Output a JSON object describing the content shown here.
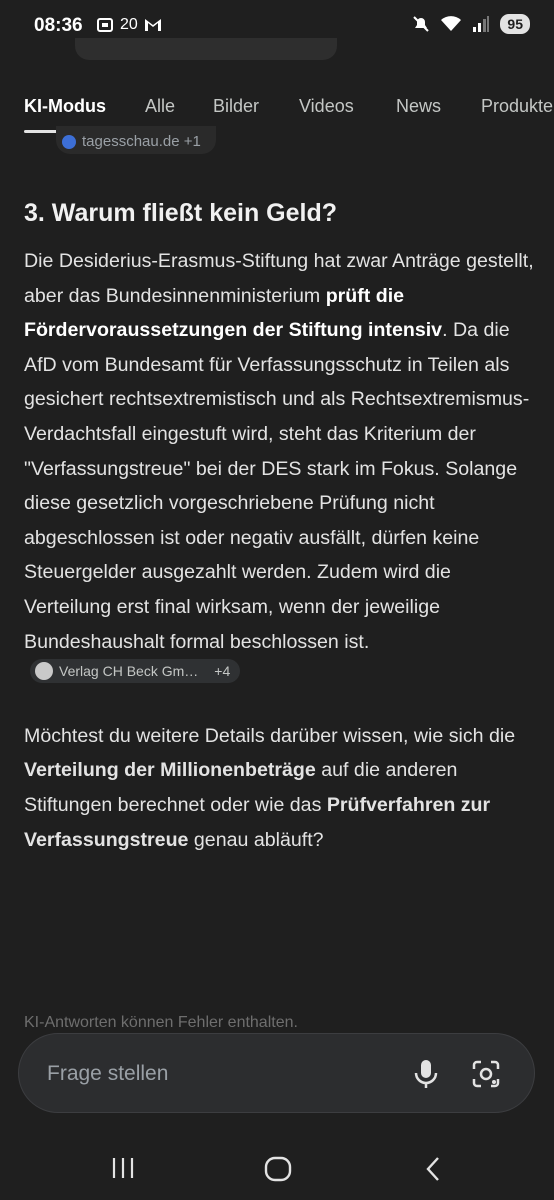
{
  "status": {
    "time": "08:36",
    "notif_count": "20",
    "battery": "95",
    "icons": [
      "screenshot-icon",
      "gmail-icon",
      "mute-icon",
      "wifi-icon",
      "signal-icon"
    ]
  },
  "tabs": [
    {
      "label": "KI-Modus",
      "active": true
    },
    {
      "label": "Alle"
    },
    {
      "label": "Bilder"
    },
    {
      "label": "Videos"
    },
    {
      "label": "News"
    },
    {
      "label": "Produkte"
    }
  ],
  "top_source": {
    "label": "tagesschau.de +1"
  },
  "section": {
    "heading": "3. Warum fließt kein Geld?",
    "p1": "Die Desiderius-Erasmus-Stiftung hat zwar Anträge gestellt, aber das Bundesinnenministerium ",
    "p1_bold": "prüft die Fördervoraussetzungen der Stiftung intensiv",
    "p2": ". Da die AfD vom Bundesamt für Verfassungsschutz in Teilen als gesichert rechtsextremistisch und als Rechtsextremismus-Verdachtsfall eingestuft wird, steht das Kriterium der \"Verfassungstreue\" bei der DES stark im Fokus. Solange diese gesetzlich vorgeschriebene Prüfung nicht abgeschlossen ist oder negativ ausfällt, dürfen keine Steuergelder ausgezahlt werden. Zudem wird die Verteilung erst final wirksam, wenn der jeweilige Bundeshaushalt formal beschlossen ist.",
    "cite_label": "Verlag CH Beck Gm…",
    "cite_more": "+4"
  },
  "followup": {
    "t1": "Möchtest du weitere Details darüber wissen, wie sich die ",
    "b1": "Verteilung der Millionenbeträge",
    "t2": " auf die anderen Stiftungen berechnet oder wie das ",
    "b2": "Prüfverfahren zur Verfassungstreue",
    "t3": " genau abläuft?"
  },
  "disclaimer": "KI-Antworten können Fehler enthalten.",
  "ask": {
    "placeholder": "Frage stellen"
  }
}
